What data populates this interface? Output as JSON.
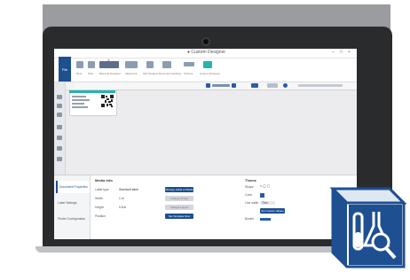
{
  "window": {
    "title": "● Custom Designer",
    "minimize": "–",
    "maximize": "□",
    "close": "×"
  },
  "ribbon": {
    "file_tab": "File",
    "tab_close": "×",
    "labels": [
      "New",
      "Print",
      "Barcode Designer",
      "Alignment",
      "Tab Designer",
      "Document Settings",
      "Printers",
      "Custom Designer"
    ]
  },
  "toolbar": {
    "icons": [
      "first-page-icon",
      "prev-page-icon",
      "next-page-icon",
      "last-page-icon",
      "play-icon",
      "zoom-icon",
      "help-icon"
    ]
  },
  "bottom_panel": {
    "tabs": [
      "Document Properties",
      "Label Settings",
      "Printer Configuration"
    ],
    "active_tab": 0,
    "section_title": "Media Info",
    "fields": [
      {
        "label": "Label type",
        "value": "Standard label"
      },
      {
        "label": "Width",
        "value": "1 in"
      },
      {
        "label": "Height",
        "value": "0.5 in"
      },
      {
        "label": "Position",
        "value": ""
      }
    ],
    "buttons": {
      "primary": "Change Label or Media",
      "disabled1": "Change Printer",
      "disabled2": "Change Layout",
      "secondary": "Set Template Now"
    },
    "right_section": {
      "title": "Theme",
      "fields": [
        {
          "label": "Shape",
          "value": "□ ◯ ▢"
        },
        {
          "label": "Color",
          "value": ""
        },
        {
          "label": "Line width",
          "value": "Thin"
        },
        {
          "label": "Border",
          "value": ""
        }
      ],
      "button": "Set Custom Values"
    }
  },
  "colors": {
    "brand_blue": "#1d4f91",
    "accent_teal": "#26b2ad",
    "icon_blue": "#1d4f91"
  },
  "app_icon": {
    "name": "lab-flask-cube-icon",
    "background": "#1d4f91"
  }
}
